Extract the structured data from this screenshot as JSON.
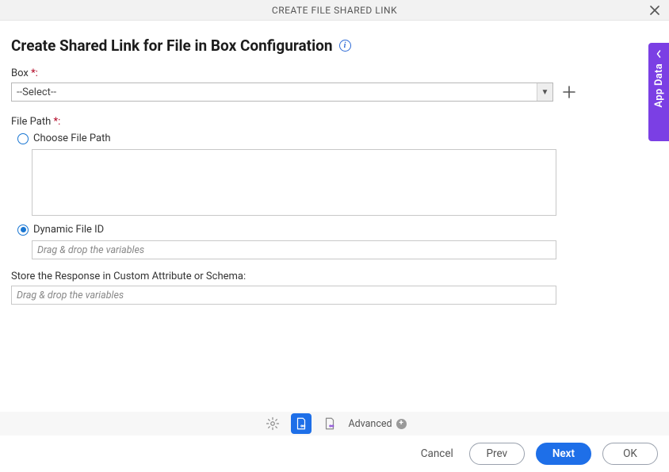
{
  "header": {
    "title": "CREATE FILE SHARED LINK"
  },
  "page": {
    "title": "Create Shared Link for File in Box Configuration"
  },
  "fields": {
    "box": {
      "label": "Box ",
      "required_suffix": "*:",
      "placeholder": "--Select--"
    },
    "filepath": {
      "label": "File Path ",
      "required_suffix": "*:",
      "option_choose": "Choose File Path",
      "option_dynamic": "Dynamic File ID",
      "drop_placeholder": "Drag & drop the variables"
    },
    "store": {
      "label": "Store the Response in Custom Attribute or Schema:",
      "drop_placeholder": "Drag & drop the variables"
    }
  },
  "sidetab": {
    "label": "App Data"
  },
  "toolbar": {
    "advanced_label": "Advanced"
  },
  "footer": {
    "cancel": "Cancel",
    "prev": "Prev",
    "next": "Next",
    "ok": "OK"
  }
}
